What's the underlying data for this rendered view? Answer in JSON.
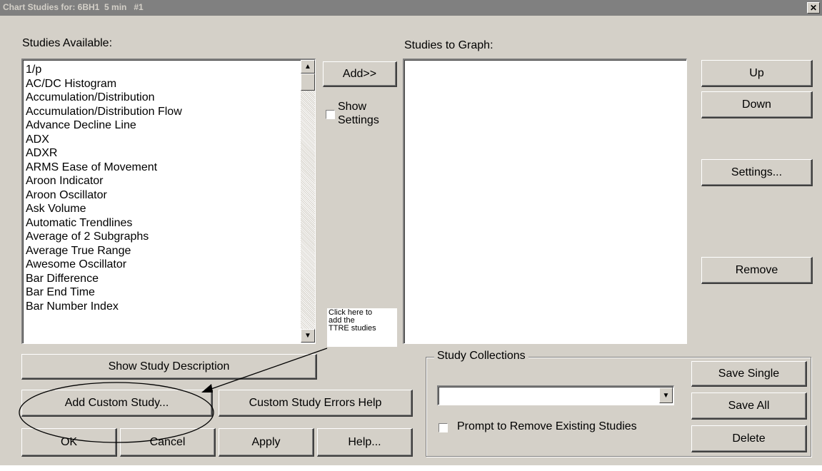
{
  "window": {
    "title": "Chart Studies for: 6BH1  5 min   #1",
    "close_glyph": "✕"
  },
  "studies_available": {
    "label": "Studies Available:",
    "items": [
      "1/p",
      "AC/DC Histogram",
      "Accumulation/Distribution",
      "Accumulation/Distribution Flow",
      "Advance Decline Line",
      "ADX",
      "ADXR",
      "ARMS Ease of Movement",
      "Aroon Indicator",
      "Aroon Oscillator",
      "Ask Volume",
      "Automatic Trendlines",
      "Average of 2 Subgraphs",
      "Average True Range",
      "Awesome Oscillator",
      "Bar Difference",
      "Bar End Time",
      "Bar Number Index"
    ]
  },
  "add_button": "Add>>",
  "show_settings": {
    "label_line1": "Show",
    "label_line2": "Settings",
    "checked": false
  },
  "studies_to_graph": {
    "label": "Studies to Graph:",
    "items": []
  },
  "right_buttons": {
    "up": "Up",
    "down": "Down",
    "settings": "Settings...",
    "remove": "Remove"
  },
  "annotation": {
    "line1": "Click here to",
    "line2": "add the",
    "line3": "TTRE studies"
  },
  "buttons": {
    "show_study_description": "Show Study Description",
    "add_custom_study": "Add Custom Study...",
    "custom_study_errors_help": "Custom Study Errors Help",
    "ok": "OK",
    "cancel": "Cancel",
    "apply": "Apply",
    "help": "Help..."
  },
  "study_collections": {
    "label": "Study Collections",
    "selected_value": "",
    "prompt_label": "Prompt to Remove Existing Studies",
    "prompt_checked": false,
    "save_single": "Save Single",
    "save_all": "Save All",
    "delete": "Delete"
  }
}
